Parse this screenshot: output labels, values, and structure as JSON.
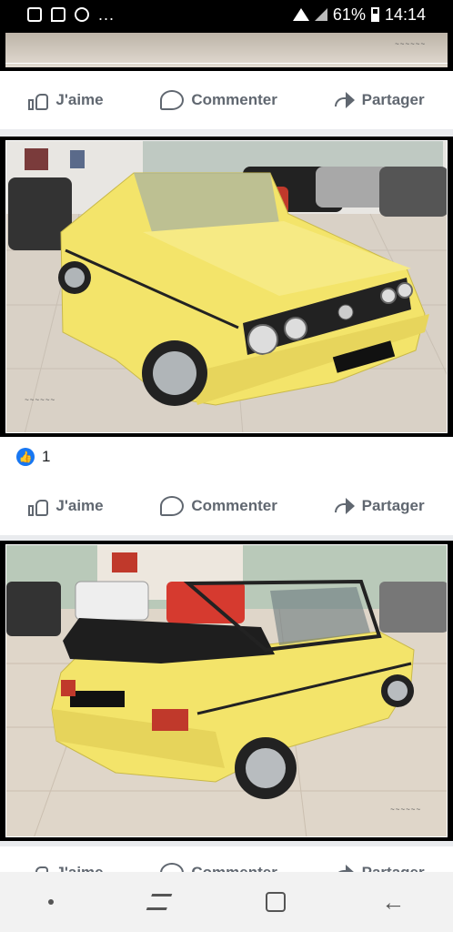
{
  "status_bar": {
    "dots": "...",
    "battery_percent": "61%",
    "time": "14:14",
    "icons": [
      "gallery-icon",
      "message-icon",
      "sync-icon",
      "wifi-icon",
      "signal-icon",
      "battery-icon"
    ]
  },
  "post_actions": {
    "like": "J'aime",
    "comment": "Commenter",
    "share": "Partager"
  },
  "post2": {
    "reaction_count": "1",
    "image_alt": "Yellow Volkswagen Golf convertible, front view, in showroom"
  },
  "post3": {
    "image_alt": "Yellow Volkswagen Golf convertible, rear view, top down, in showroom"
  },
  "colors": {
    "facebook_blue": "#1877f2",
    "action_text": "#606770",
    "car_yellow": "#f3e46a"
  },
  "nav": {
    "items": [
      "dot",
      "recent-apps",
      "home",
      "back"
    ]
  }
}
